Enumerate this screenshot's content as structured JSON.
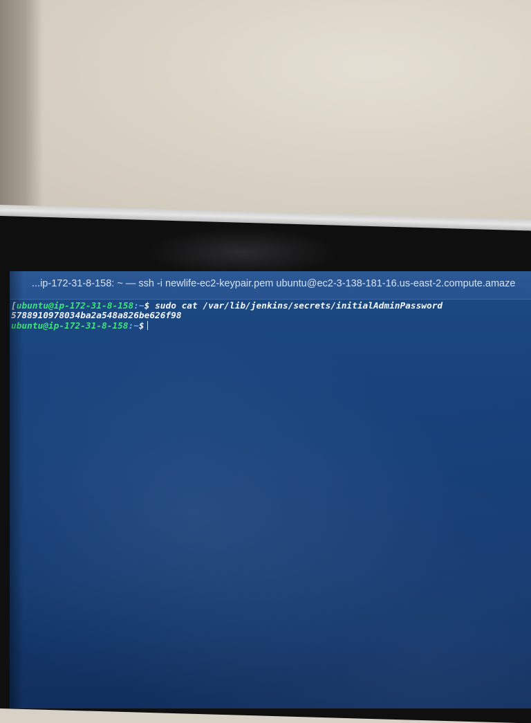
{
  "window": {
    "title": "...ip-172-31-8-158: ~ — ssh -i newlife-ec2-keypair.pem ubuntu@ec2-3-138-181-16.us-east-2.compute.amaze"
  },
  "terminal": {
    "lines": [
      {
        "bracket": "[",
        "prompt_user": "ubuntu@ip-172-31-8-158",
        "prompt_path": ":~",
        "prompt_symbol": "$",
        "command": "sudo cat /var/lib/jenkins/secrets/initialAdminPassword"
      },
      {
        "output": "5788910978034ba2a548a826be626f98"
      },
      {
        "prompt_user": "ubuntu@ip-172-31-8-158",
        "prompt_path": ":~",
        "prompt_symbol": "$",
        "command": ""
      }
    ]
  },
  "colors": {
    "screen_background": "#17407a",
    "prompt_user": "#3fe27c",
    "prompt_path": "#6fb4ff",
    "text": "#f4f6fa"
  }
}
